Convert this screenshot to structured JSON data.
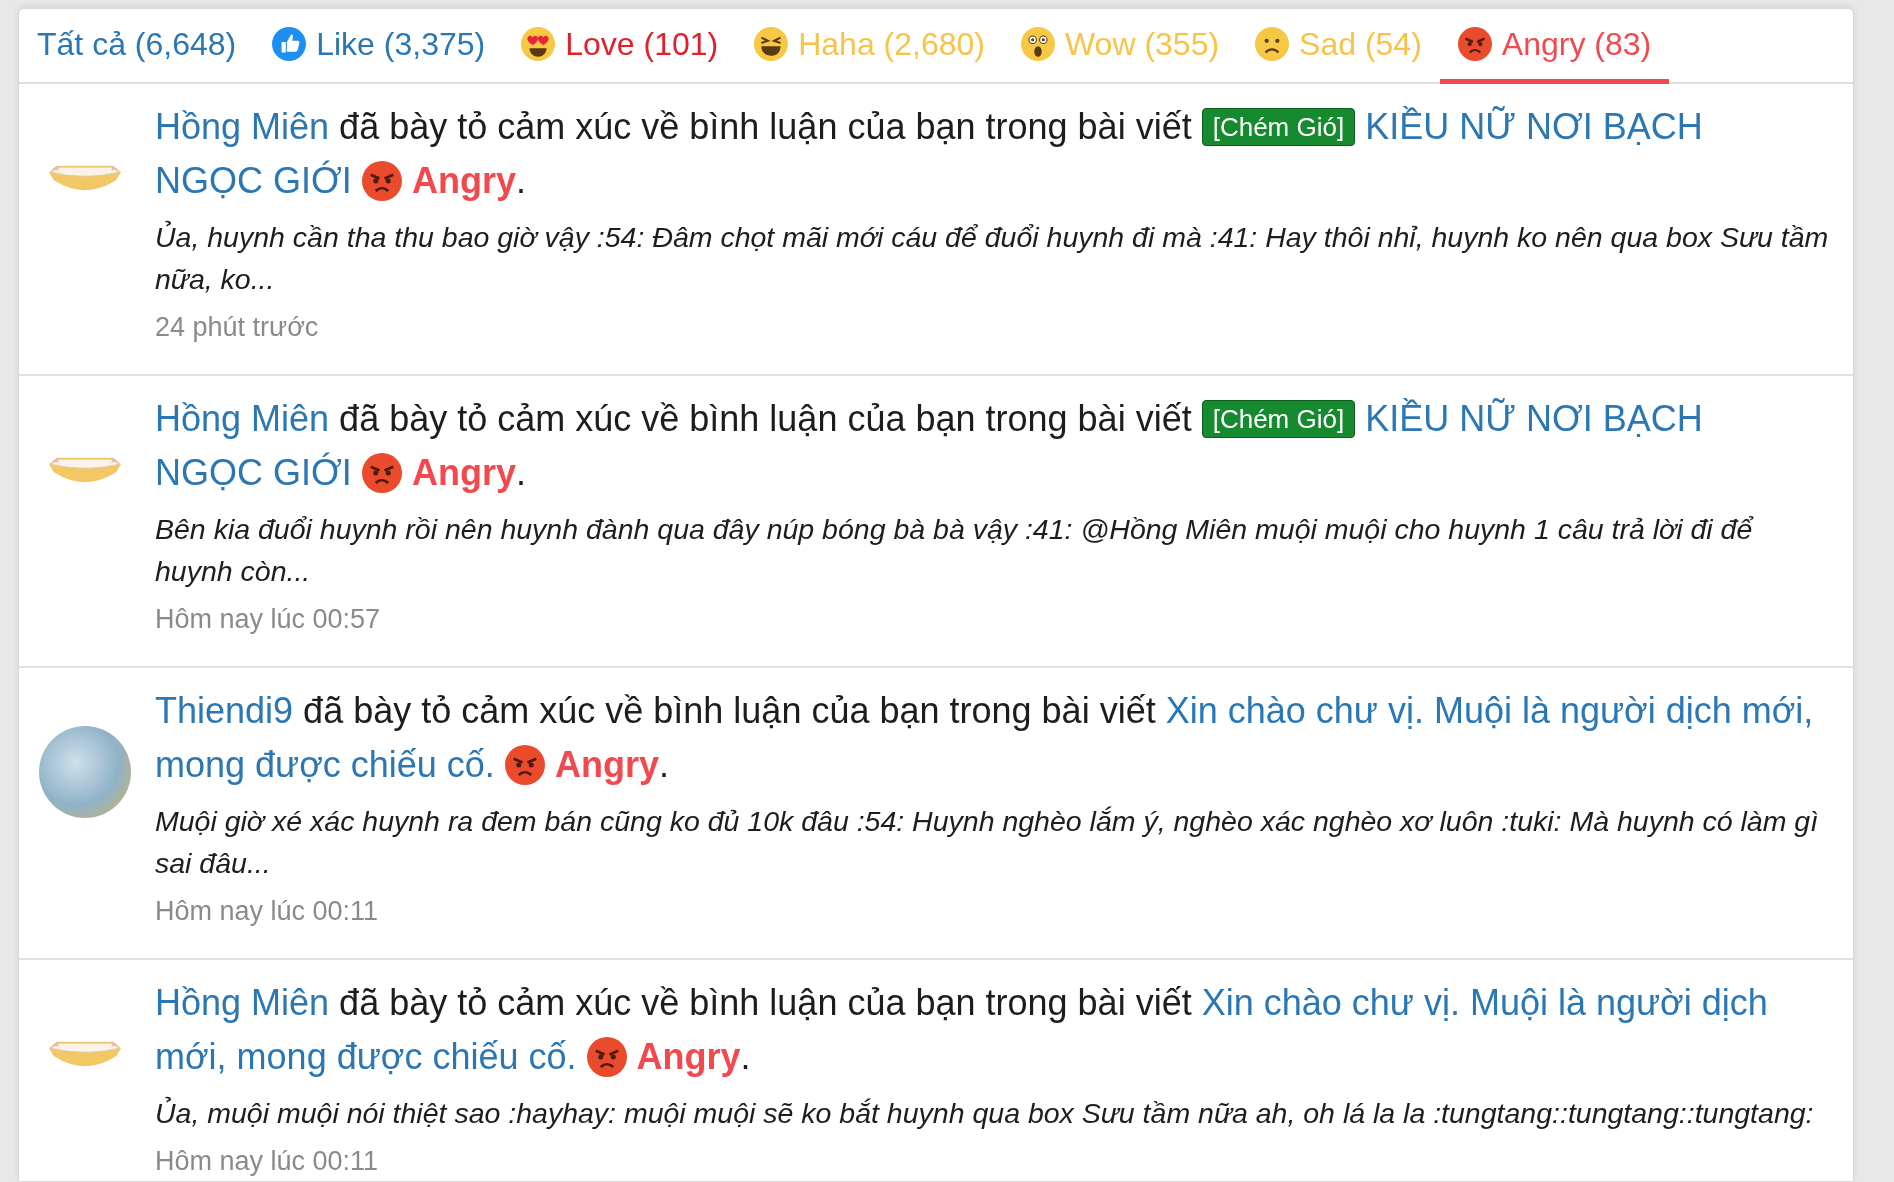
{
  "tabs": [
    {
      "label": "Tất cả (6,648)",
      "kind": "all",
      "color": "#2b77b3",
      "selected": false
    },
    {
      "label": "Like (3,375)",
      "kind": "like",
      "color": "#2b77b3",
      "selected": false
    },
    {
      "label": "Love (101)",
      "kind": "love",
      "color": "#e0212c",
      "selected": false
    },
    {
      "label": "Haha (2,680)",
      "kind": "haha",
      "color": "#f8c34a",
      "selected": false
    },
    {
      "label": "Wow (355)",
      "kind": "wow",
      "color": "#f8c34a",
      "selected": false
    },
    {
      "label": "Sad (54)",
      "kind": "sad",
      "color": "#f8c34a",
      "selected": false
    },
    {
      "label": "Angry (83)",
      "kind": "angry",
      "color": "#f2494f",
      "selected": true
    }
  ],
  "notifications": [
    {
      "kind": "cat",
      "user": "Hồng Miên",
      "action": "đã bày tỏ cảm xúc về bình luận của bạn trong bài viết",
      "tag": "[Chém Gió]",
      "thread_lines": [
        "KIỀU NỮ NƠI BẠCH",
        "NGỌC GIỚI"
      ],
      "reaction": {
        "kind": "angry",
        "label": "Angry"
      },
      "end": ".",
      "snippet": "Ủa, huynh cần tha thu bao giờ vậy :54: Đâm chọt mãi mới cáu để đuổi huynh đi mà :41: Hay thôi nhỉ, huynh ko nên qua box Sưu tầm nữa, ko...",
      "time": "24 phút trước"
    },
    {
      "kind": "cat",
      "user": "Hồng Miên",
      "action": "đã bày tỏ cảm xúc về bình luận của bạn trong bài viết",
      "tag": "[Chém Gió]",
      "thread_lines": [
        "KIỀU NỮ NƠI BẠCH",
        "NGỌC GIỚI"
      ],
      "reaction": {
        "kind": "angry",
        "label": "Angry"
      },
      "end": ".",
      "snippet": "Bên kia đuổi huynh rồi nên huynh đành qua đây núp bóng bà bà vậy :41: @Hồng Miên muội muội cho huynh 1 câu trả lời đi để huynh còn...",
      "time": "Hôm nay lúc 00:57"
    },
    {
      "kind": "photo",
      "user": "Thiendi9",
      "action": "đã bày tỏ cảm xúc về bình luận của bạn trong bài viết",
      "thread_lines": [
        "Xin chào chư vị. Muội là người dịch mới,",
        "mong được chiếu cố."
      ],
      "reaction": {
        "kind": "angry",
        "label": "Angry"
      },
      "end": ".",
      "snippet": "Muội giờ xé xác huynh ra đem bán cũng ko đủ 10k đâu :54: Huynh nghèo lắm ý, nghèo xác nghèo xơ luôn :tuki: Mà huynh có làm gì sai đâu...",
      "time": "Hôm nay lúc 00:11"
    },
    {
      "kind": "cat",
      "user": "Hồng Miên",
      "action": "đã bày tỏ cảm xúc về bình luận của bạn trong bài viết",
      "thread_lines": [
        "Xin chào chư vị. Muội là người dịch",
        "mới, mong được chiếu cố."
      ],
      "reaction": {
        "kind": "angry",
        "label": "Angry"
      },
      "end": ".",
      "snippet": "Ủa, muội muội nói thiệt sao :hayhay: muội muội sẽ ko bắt huynh qua box Sưu tầm nữa ah, oh lá la la :tungtang::tungtang::tungtang:",
      "time": "Hôm nay lúc 00:11"
    }
  ]
}
